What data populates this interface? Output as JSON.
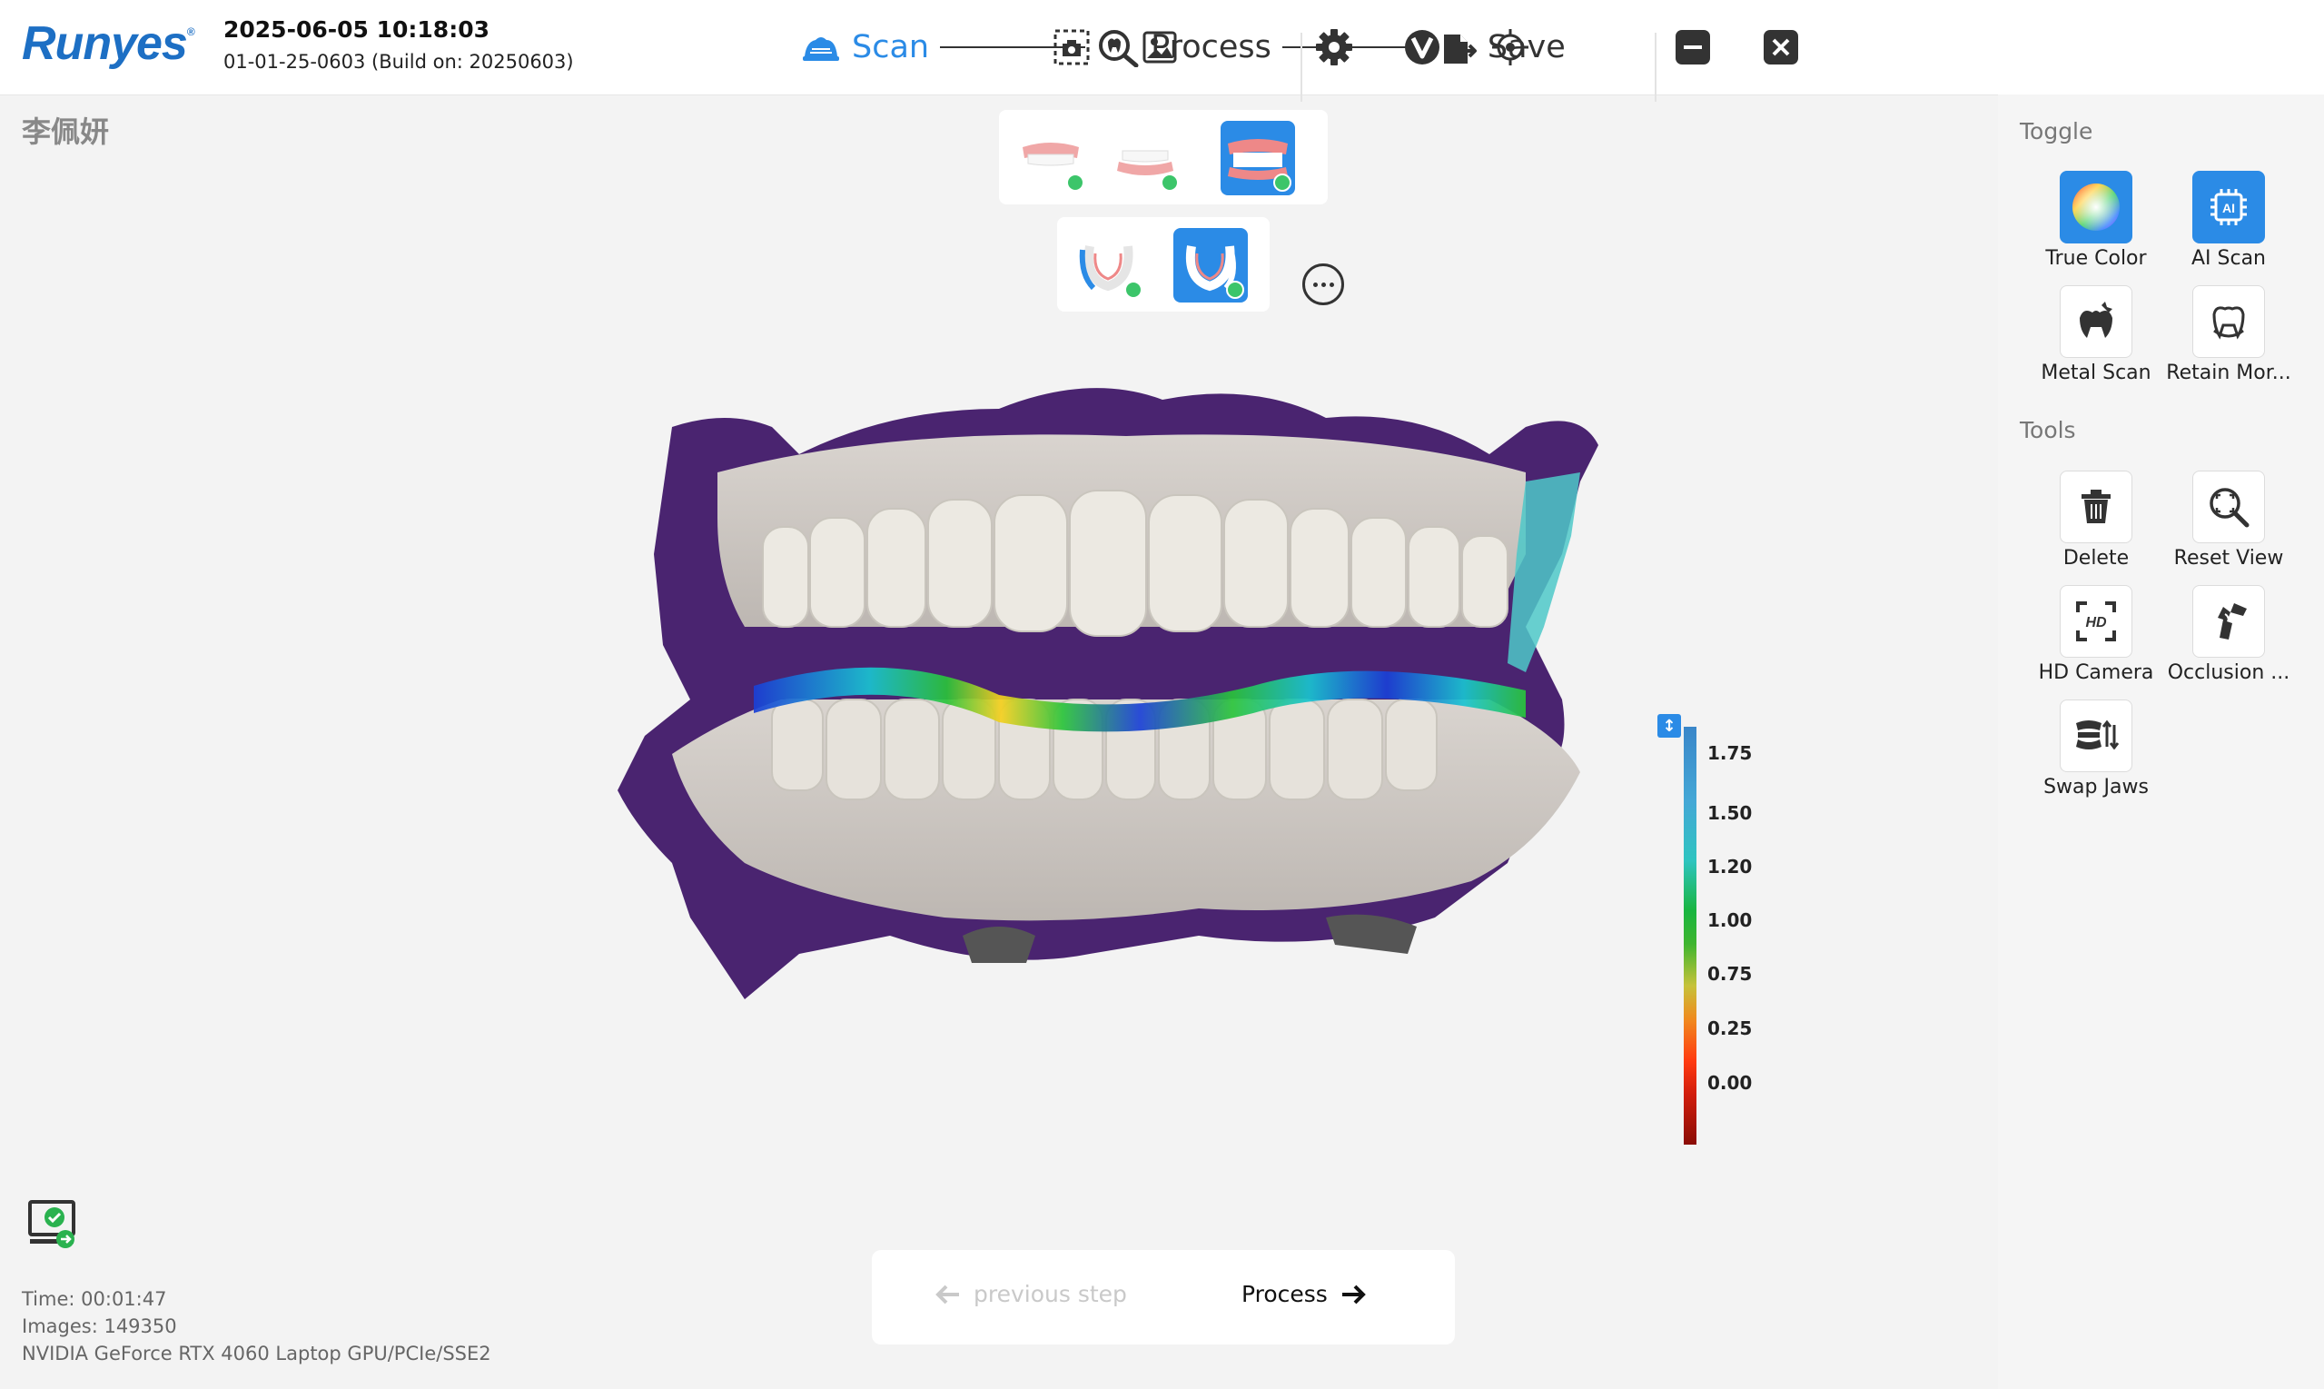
{
  "app": {
    "logo": "Runyes",
    "logo_mark": "®",
    "datetime": "2025-06-05 10:18:03",
    "build": "01-01-25-0603 (Build on: 20250603)"
  },
  "steps": [
    {
      "label": "Scan",
      "icon": "tooth-scan-icon",
      "active": true
    },
    {
      "label": "Process",
      "icon": "magnifier-tooth-icon",
      "active": false
    },
    {
      "label": "Save",
      "icon": "save-document-icon",
      "active": false
    }
  ],
  "toolbar_icons": [
    "screenshot-camera-icon",
    "image-gallery-icon",
    "gear-icon",
    "v-logo-icon",
    "crosshair-icon",
    "minimize-icon",
    "close-icon"
  ],
  "patient_name": "李佩妍",
  "jaw_selector": {
    "row1": [
      "upper-jaw-icon",
      "lower-jaw-icon",
      "bite-icon"
    ],
    "row1_selected": 2,
    "row2": [
      "buccal-left-icon",
      "buccal-right-icon"
    ],
    "row2_selected": 1
  },
  "color_scale": {
    "labels": [
      "1.75",
      "1.50",
      "1.20",
      "1.00",
      "0.75",
      "0.25",
      "0.00"
    ]
  },
  "right_panel": {
    "toggle_title": "Toggle",
    "tools_title": "Tools",
    "toggle_items": [
      {
        "label": "True Color",
        "icon": "color-wheel-icon",
        "active": true
      },
      {
        "label": "AI Scan",
        "icon": "ai-chip-icon",
        "active": true
      },
      {
        "label": "Metal Scan",
        "icon": "metal-tooth-icon",
        "active": false
      },
      {
        "label": "Retain Mor...",
        "icon": "retain-tooth-icon",
        "active": false
      }
    ],
    "tool_items": [
      {
        "label": "Delete",
        "icon": "trash-icon"
      },
      {
        "label": "Reset View",
        "icon": "zoom-reset-icon"
      },
      {
        "label": "HD Camera",
        "icon": "hd-camera-icon"
      },
      {
        "label": "Occlusion ...",
        "icon": "occlusion-icon"
      },
      {
        "label": "Swap Jaws",
        "icon": "swap-jaws-icon"
      }
    ]
  },
  "info": {
    "time": "Time: 00:01:47",
    "images": "Images: 149350",
    "gpu": "NVIDIA GeForce RTX 4060 Laptop GPU/PCIe/SSE2"
  },
  "nav": {
    "prev_label": "previous step",
    "next_label": "Process"
  }
}
